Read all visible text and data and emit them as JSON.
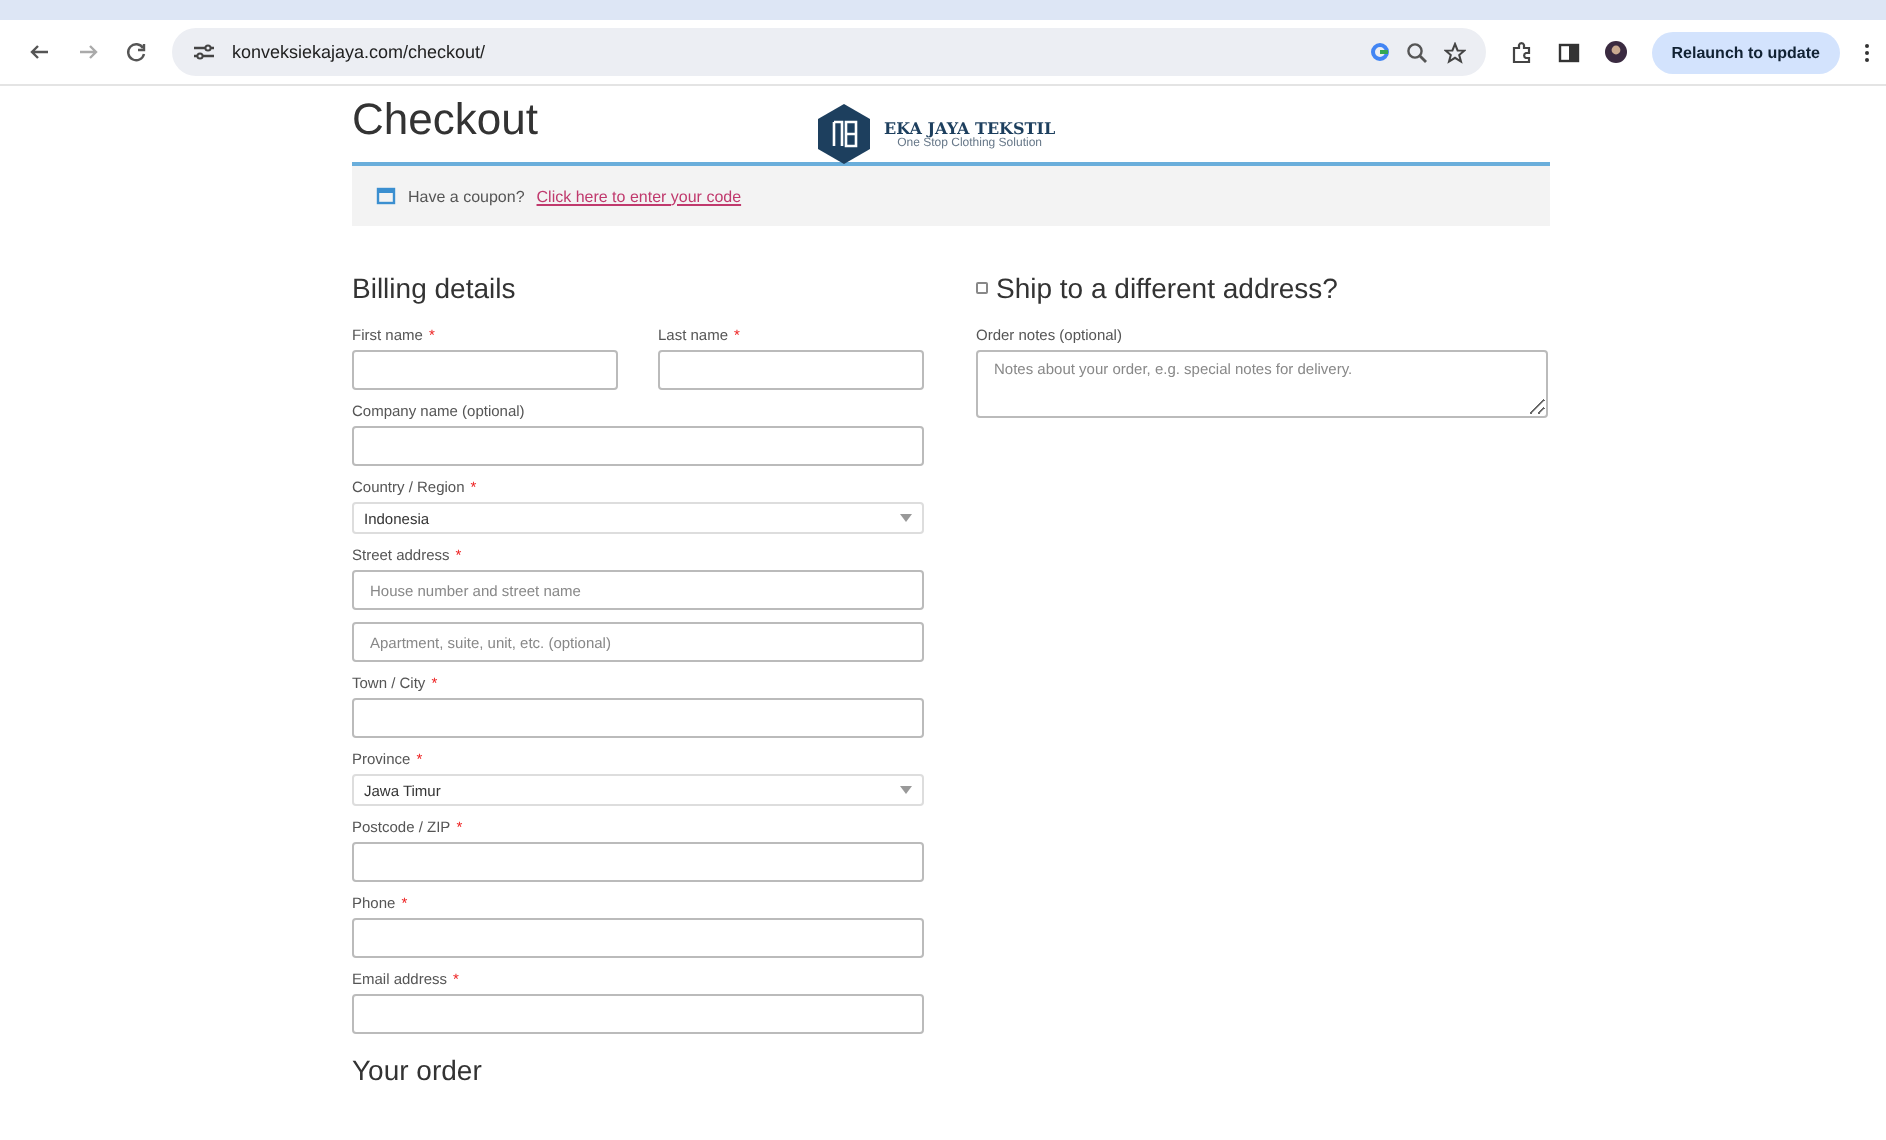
{
  "browser": {
    "url": "konveksiekajaya.com/checkout/",
    "relaunch_label": "Relaunch to update"
  },
  "page": {
    "title": "Checkout",
    "brand": "EKA JAYA TEKSTIL",
    "tagline": "One Stop Clothing Solution"
  },
  "coupon": {
    "text": "Have a coupon?",
    "link": "Click here to enter your code"
  },
  "billing": {
    "heading": "Billing details",
    "fields": [
      {
        "kind": "pair",
        "items": [
          {
            "label": "First name",
            "required_mark": "*",
            "kind": "input"
          },
          {
            "label": "Last name",
            "required_mark": "*",
            "kind": "input"
          }
        ]
      },
      {
        "kind": "input",
        "label": "Company name (optional)"
      },
      {
        "kind": "select",
        "label": "Country / Region",
        "required_mark": "*",
        "value": "Indonesia"
      },
      {
        "kind": "input",
        "label": "Street address",
        "required_mark": "*",
        "placeholder": "House number and street name"
      },
      {
        "kind": "input",
        "placeholder": "Apartment, suite, unit, etc. (optional)"
      },
      {
        "kind": "input",
        "label": "Town / City",
        "required_mark": "*"
      },
      {
        "kind": "select",
        "label": "Province",
        "required_mark": "*",
        "value": "Jawa Timur"
      },
      {
        "kind": "input",
        "label": "Postcode / ZIP",
        "required_mark": "*"
      },
      {
        "kind": "input",
        "label": "Phone",
        "required_mark": "*"
      },
      {
        "kind": "input",
        "label": "Email address",
        "required_mark": "*"
      }
    ]
  },
  "shipping": {
    "label": "Ship to a different address?",
    "checked": false,
    "notes_label": "Order notes (optional)",
    "notes_placeholder": "Notes about your order, e.g. special notes for delivery."
  },
  "order": {
    "heading": "Your order"
  }
}
